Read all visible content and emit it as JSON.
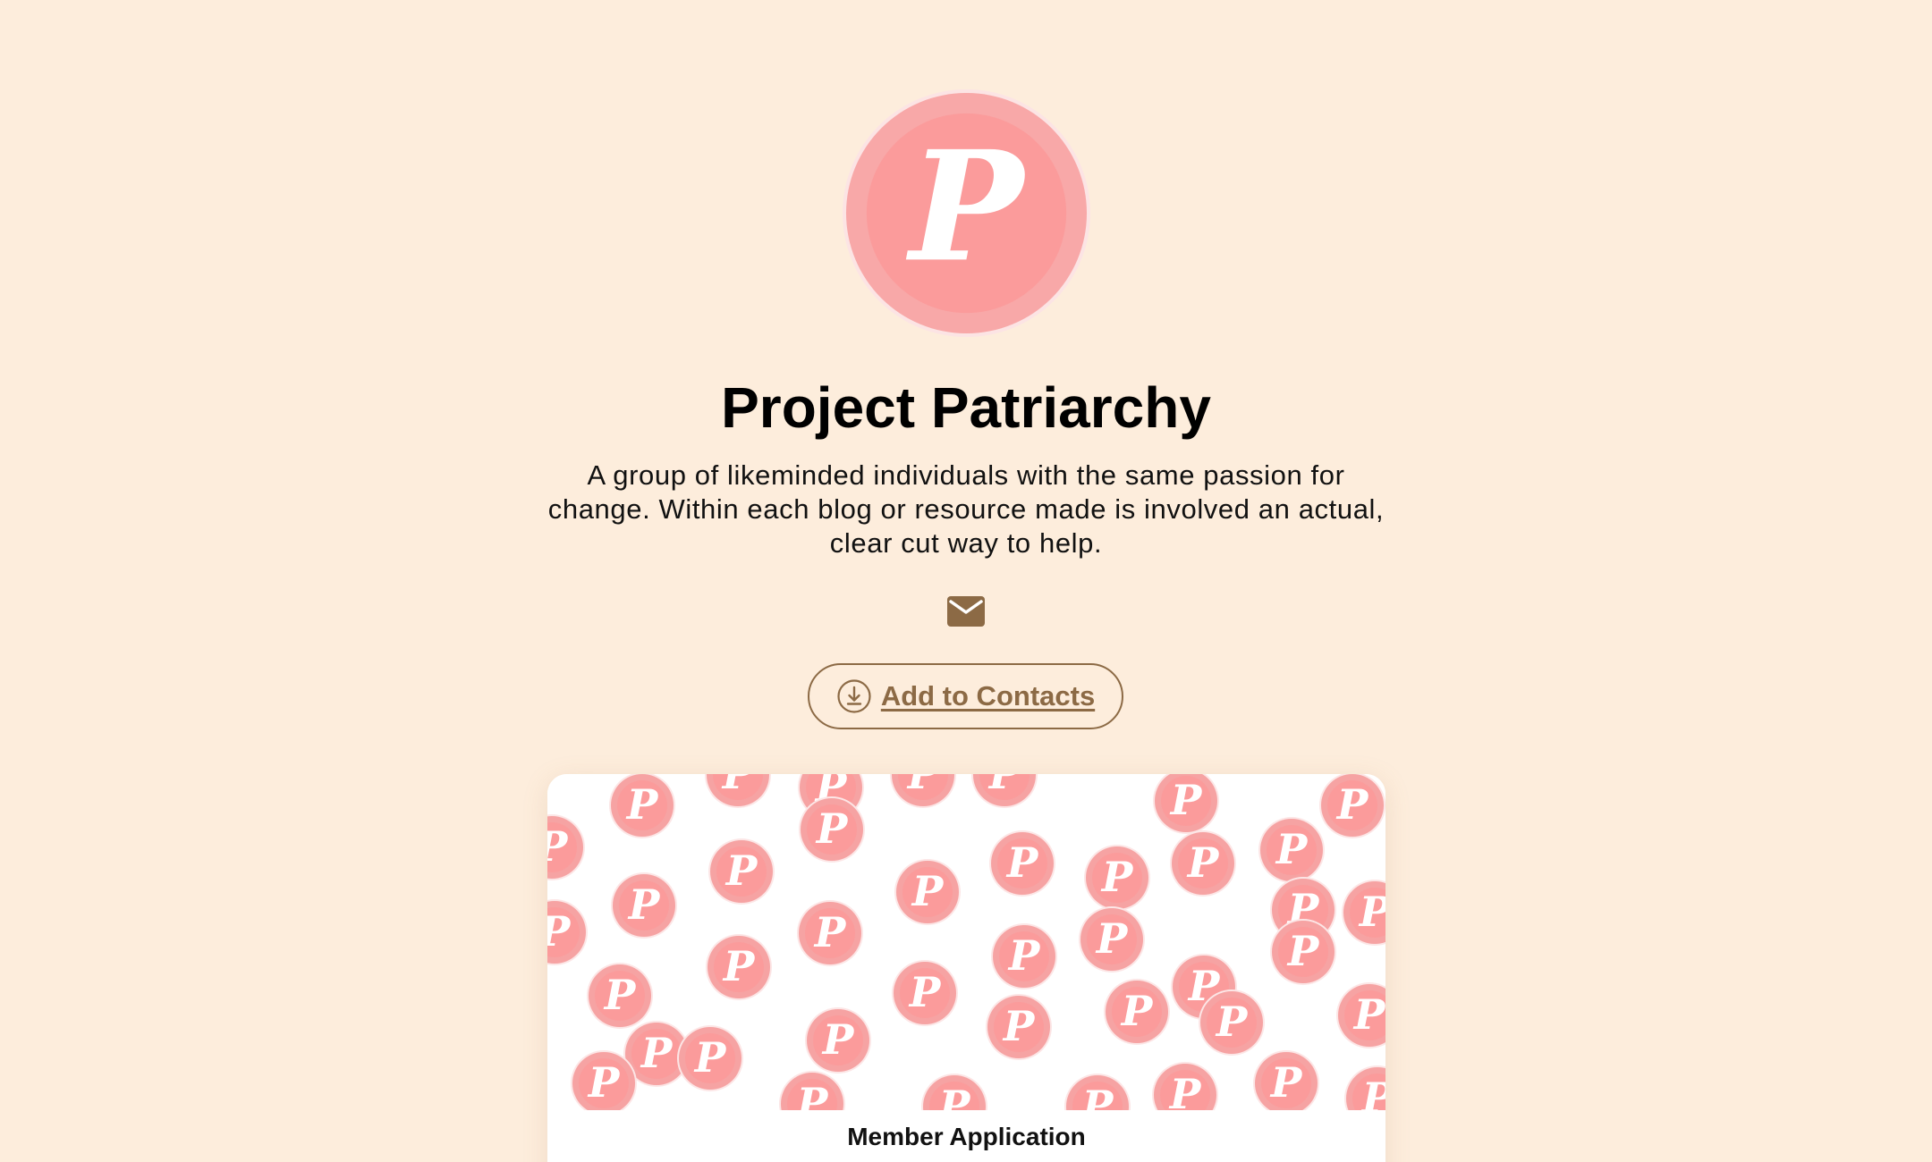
{
  "profile": {
    "name": "Project Patriarchy",
    "bio": "A group of likeminded individuals with the same passion for change. Within each blog or resource made is involved an actual, clear cut way to help.",
    "avatar_letter": "P"
  },
  "actions": {
    "email_icon": "envelope-icon",
    "add_contacts_label": "Add to Contacts",
    "add_contacts_icon": "download-circle-icon"
  },
  "links": [
    {
      "title": "Member Application",
      "thumbnail": "repeating-logo-pattern"
    }
  ],
  "colors": {
    "background": "#fdeddc",
    "accent": "#8c6a45",
    "logo_pink": "#f59a9c",
    "logo_inner": "#fd9a9a"
  }
}
